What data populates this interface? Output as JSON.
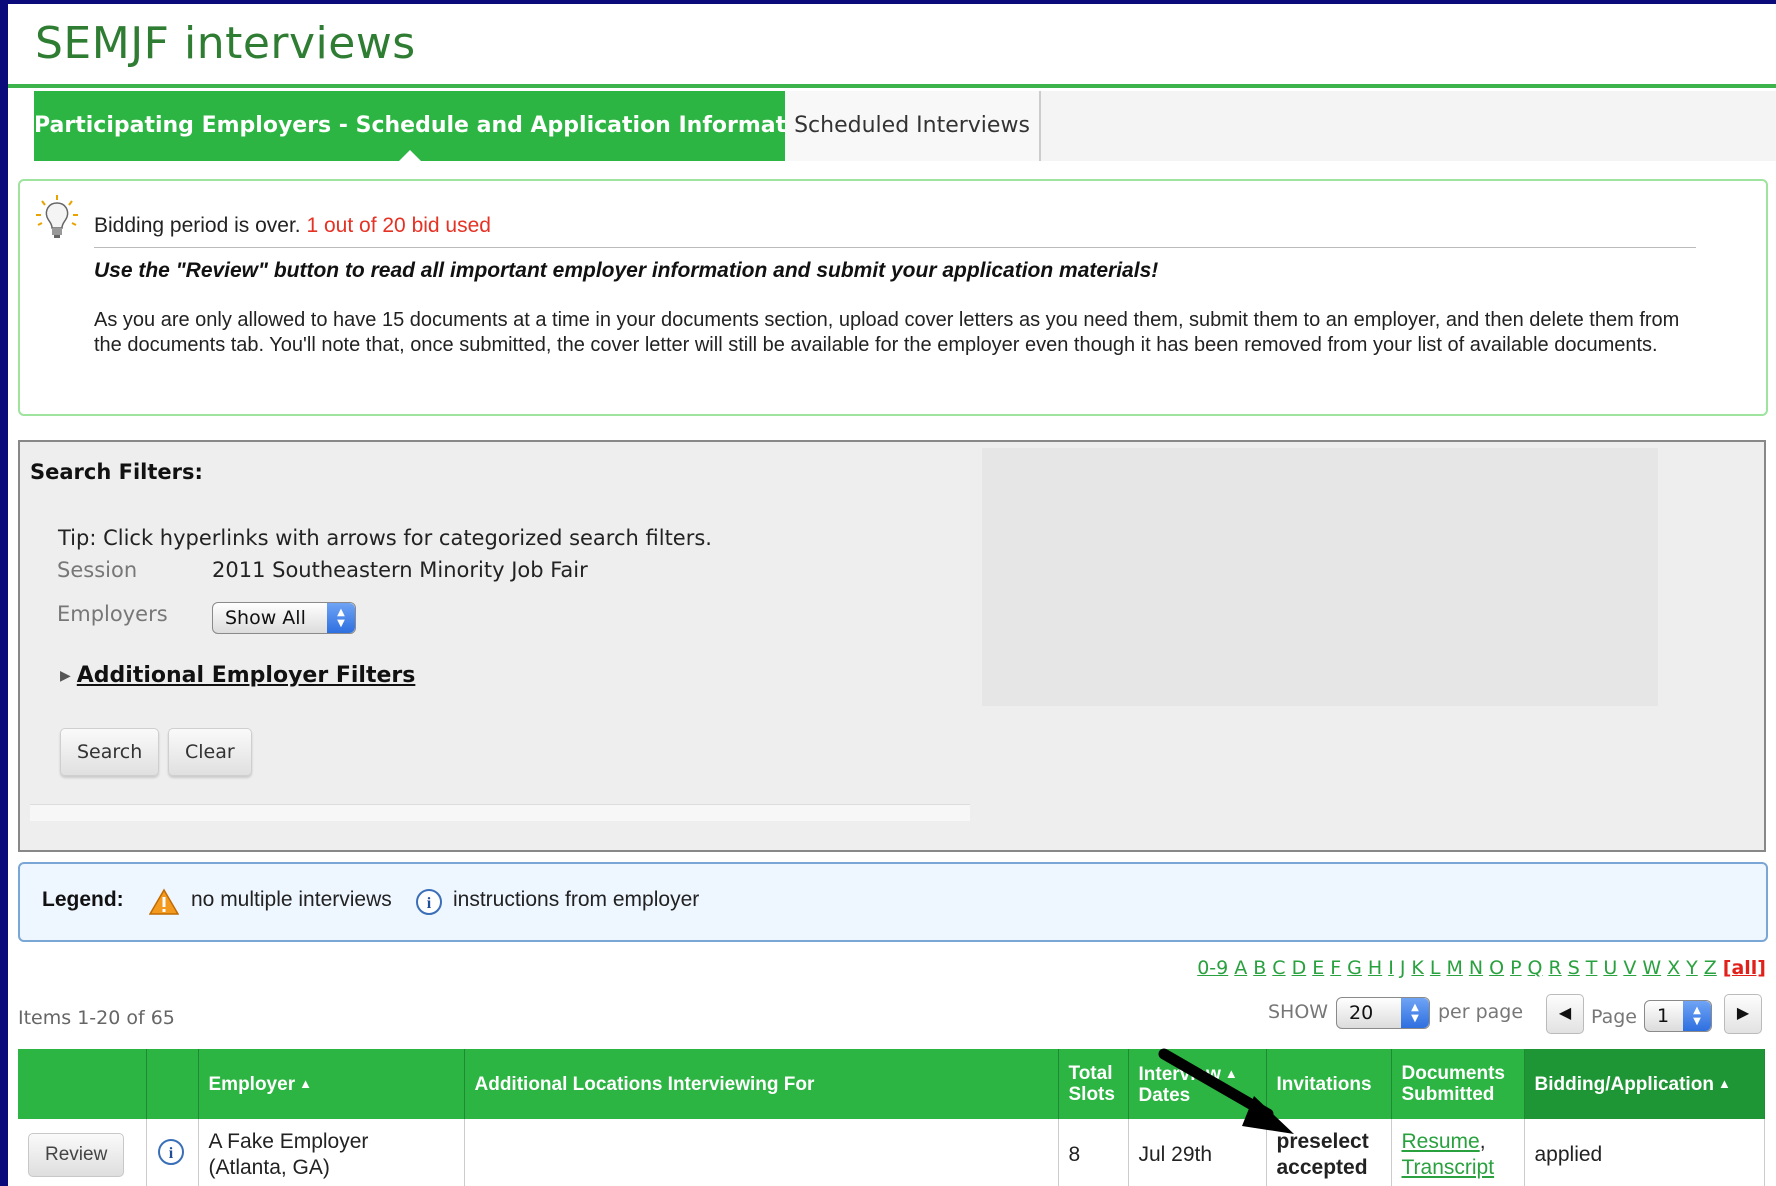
{
  "app": {
    "title": "SEMJF interviews"
  },
  "tabs": [
    {
      "label": "Participating Employers - Schedule and Application Information",
      "active": true
    },
    {
      "label": "Scheduled Interviews",
      "active": false
    }
  ],
  "notice": {
    "status": "Bidding period is over.",
    "bid_count": "1 out of 20 bid used",
    "instruction": "Use the \"Review\" button to read all important employer information and submit your application materials!",
    "paragraph": "As you are only allowed to have 15 documents at a time in your documents section, upload cover letters as you need them, submit them to an employer, and then delete them from the documents tab. You'll note that, once submitted, the cover letter will still be available for the employer even though it has been removed from your list of available documents."
  },
  "filters": {
    "header": "Search Filters:",
    "tip": "Tip: Click hyperlinks with arrows for categorized search filters.",
    "session_label": "Session",
    "session_value": "2011 Southeastern Minority Job Fair",
    "employers_label": "Employers",
    "employers_value": "Show All",
    "additional_link": "Additional Employer Filters",
    "search_button": "Search",
    "clear_button": "Clear"
  },
  "legend": {
    "label": "Legend:",
    "warning_text": "no multiple interviews",
    "info_text": "instructions from employer"
  },
  "alphabet": [
    "0-9",
    "A",
    "B",
    "C",
    "D",
    "E",
    "F",
    "G",
    "H",
    "I",
    "J",
    "K",
    "L",
    "M",
    "N",
    "O",
    "P",
    "Q",
    "R",
    "S",
    "T",
    "U",
    "V",
    "W",
    "X",
    "Y",
    "Z",
    "[all]"
  ],
  "pagination": {
    "items": "Items 1-20 of 65",
    "show_label": "SHOW",
    "per_page_value": "20",
    "per_page_label": "per page",
    "page_label": "Page",
    "page_value": "1"
  },
  "table": {
    "headers": {
      "employer": "Employer",
      "locations": "Additional Locations Interviewing For",
      "total_slots_1": "Total",
      "total_slots_2": "Slots",
      "dates_1": "Interview",
      "dates_2": "Dates",
      "invitations": "Invitations",
      "docs_1": "Documents",
      "docs_2": "Submitted",
      "bidding": "Bidding/Application"
    },
    "rows": [
      {
        "review": "Review",
        "employer_line1": "A Fake Employer",
        "employer_line2": "(Atlanta, GA)",
        "locations": "",
        "slots": "8",
        "dates": "Jul 29th",
        "invite_line1": "preselect",
        "invite_line2": "accepted",
        "doc1": "Resume",
        "doc2": "Transcript",
        "bidding": "applied"
      }
    ]
  },
  "colors": {
    "brand_green": "#2cb543",
    "title_green": "#2e7d32",
    "alert_red": "#e53224",
    "frame_blue": "#0a0a7a"
  }
}
